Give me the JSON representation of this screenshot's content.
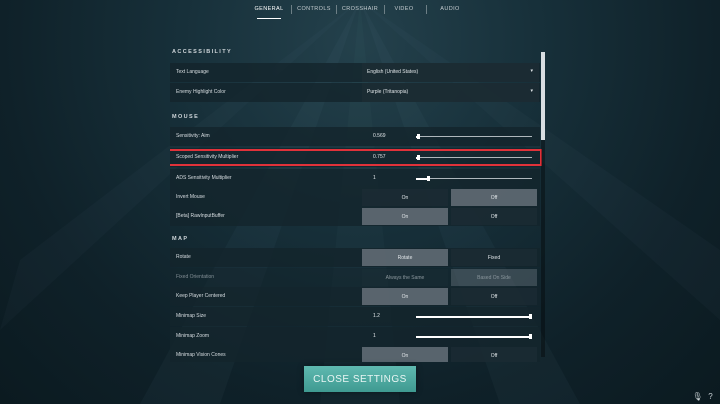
{
  "tabs": [
    {
      "label": "GENERAL",
      "active": true
    },
    {
      "label": "CONTROLS",
      "active": false
    },
    {
      "label": "CROSSHAIR",
      "active": false
    },
    {
      "label": "VIDEO",
      "active": false
    },
    {
      "label": "AUDIO",
      "active": false
    }
  ],
  "sections": {
    "accessibility": {
      "title": "ACCESSIBILITY",
      "rows": {
        "text_language": {
          "label": "Text Language",
          "value": "English (United States)"
        },
        "enemy_highlight": {
          "label": "Enemy Highlight Color",
          "value": "Purple (Tritanopia)"
        }
      }
    },
    "mouse": {
      "title": "MOUSE",
      "rows": {
        "sens_aim": {
          "label": "Sensitivity: Aim",
          "value": "0.569",
          "fraction": 0.02
        },
        "scoped_sens": {
          "label": "Scoped Sensitivity Multiplier",
          "value": "0.757",
          "fraction": 0.02
        },
        "ads_sens": {
          "label": "ADS Sensitivity Multiplier",
          "value": "1",
          "fraction": 0.1
        },
        "invert_mouse": {
          "label": "Invert Mouse",
          "on": "On",
          "off": "Off",
          "selected": "Off"
        },
        "raw_input": {
          "label": "[Beta] RawInputBuffer",
          "on": "On",
          "off": "Off",
          "selected": "On"
        }
      }
    },
    "map": {
      "title": "MAP",
      "rows": {
        "rotate": {
          "label": "Rotate",
          "opt1": "Rotate",
          "opt2": "Fixed",
          "selected": "Rotate"
        },
        "fixed_orientation": {
          "label": "Fixed Orientation",
          "opt1": "Always the Same",
          "opt2": "Based On Side",
          "selected": "Based On Side"
        },
        "keep_centered": {
          "label": "Keep Player Centered",
          "on": "On",
          "off": "Off",
          "selected": "On"
        },
        "minimap_size": {
          "label": "Minimap Size",
          "value": "1.2",
          "fraction": 1.0
        },
        "minimap_zoom": {
          "label": "Minimap Zoom",
          "value": "1",
          "fraction": 1.0
        },
        "minimap_vision": {
          "label": "Minimap Vision Cones",
          "on": "On",
          "off": "Off",
          "selected": "On"
        }
      }
    }
  },
  "close_button": "CLOSE SETTINGS",
  "icons": {
    "caret": "▾",
    "mic": "🎙",
    "help": "?"
  },
  "colors": {
    "highlight": "#e0323a",
    "accent": "#4fa9a0"
  }
}
